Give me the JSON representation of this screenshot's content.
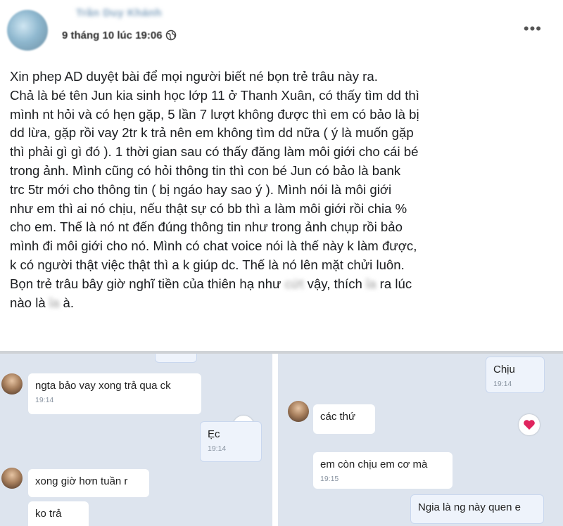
{
  "post": {
    "author": "Trần Duy Khánh",
    "date": "9 tháng 10 lúc 19:06",
    "privacy_icon": "globe-icon",
    "more_icon": "more-options-icon",
    "lines": [
      "Xin phep AD duyệt bài để mọi người biết né bọn trẻ trâu này ra.",
      "Chả là bé tên Jun kia sinh học lớp 11 ở Thanh Xuân, có thấy tìm dd thì",
      "mình nt hỏi và có hẹn gặp, 5 lần 7 lượt không được thì em có bảo là bị",
      "dd lừa, gặp rồi vay 2tr k trả nên em không tìm dd nữa ( ý là muốn gặp",
      "thì phải gì gì đó ). 1 thời gian sau có thấy đăng làm môi giới cho cái bé",
      "trong ảnh. Mình cũng có hỏi thông tin thì con bé Jun có bảo là bank",
      "trc 5tr mới cho thông tin ( bị ngáo hay sao ý ). Mình nói là môi giới",
      "như em thì ai nó chịu, nếu thật sự có bb thì a làm môi giới rồi chia %",
      "cho em. Thế là nó nt đến đúng thông tin như trong ảnh chụp rồi bảo",
      "mình đi môi giới cho nó. Mình có chat voice nói là thế này k làm được,",
      "k có người thật việc thật thì a k giúp dc. Thế là nó lên mặt chửi luôn."
    ],
    "line12": {
      "before": "Bọn trẻ trâu bây giờ nghĩ tiền của thiên hạ như ",
      "censored1": "cứt",
      "middle": " vậy, thích ",
      "censored2": "ỉa",
      "after": " ra lúc"
    },
    "line13": {
      "before": "nào là ",
      "censored": "ỉa",
      "after": " à."
    }
  },
  "chat_left": {
    "messages": [
      {
        "text": "ngta bảo vay xong trả qua ck",
        "time": "19:14",
        "sender": "other"
      },
      {
        "text": "Ẹc",
        "time": "19:14",
        "sender": "me"
      },
      {
        "text": "xong giờ hơn tuần r",
        "time": "",
        "sender": "other"
      },
      {
        "text": "ko trả",
        "time": "",
        "sender": "other"
      }
    ]
  },
  "chat_right": {
    "messages": [
      {
        "text": "Chịu",
        "time": "19:14",
        "sender": "me"
      },
      {
        "text": "các thứ",
        "time": "",
        "sender": "other"
      },
      {
        "text": "em còn chịu em cơ mà",
        "time": "19:15",
        "sender": "other"
      },
      {
        "text": "Ngia là ng này quen e",
        "time": "",
        "sender": "me"
      }
    ]
  },
  "colors": {
    "chat_bg": "#dde4ee",
    "heart": "#e0245e",
    "separator": "#cfd2d6"
  }
}
